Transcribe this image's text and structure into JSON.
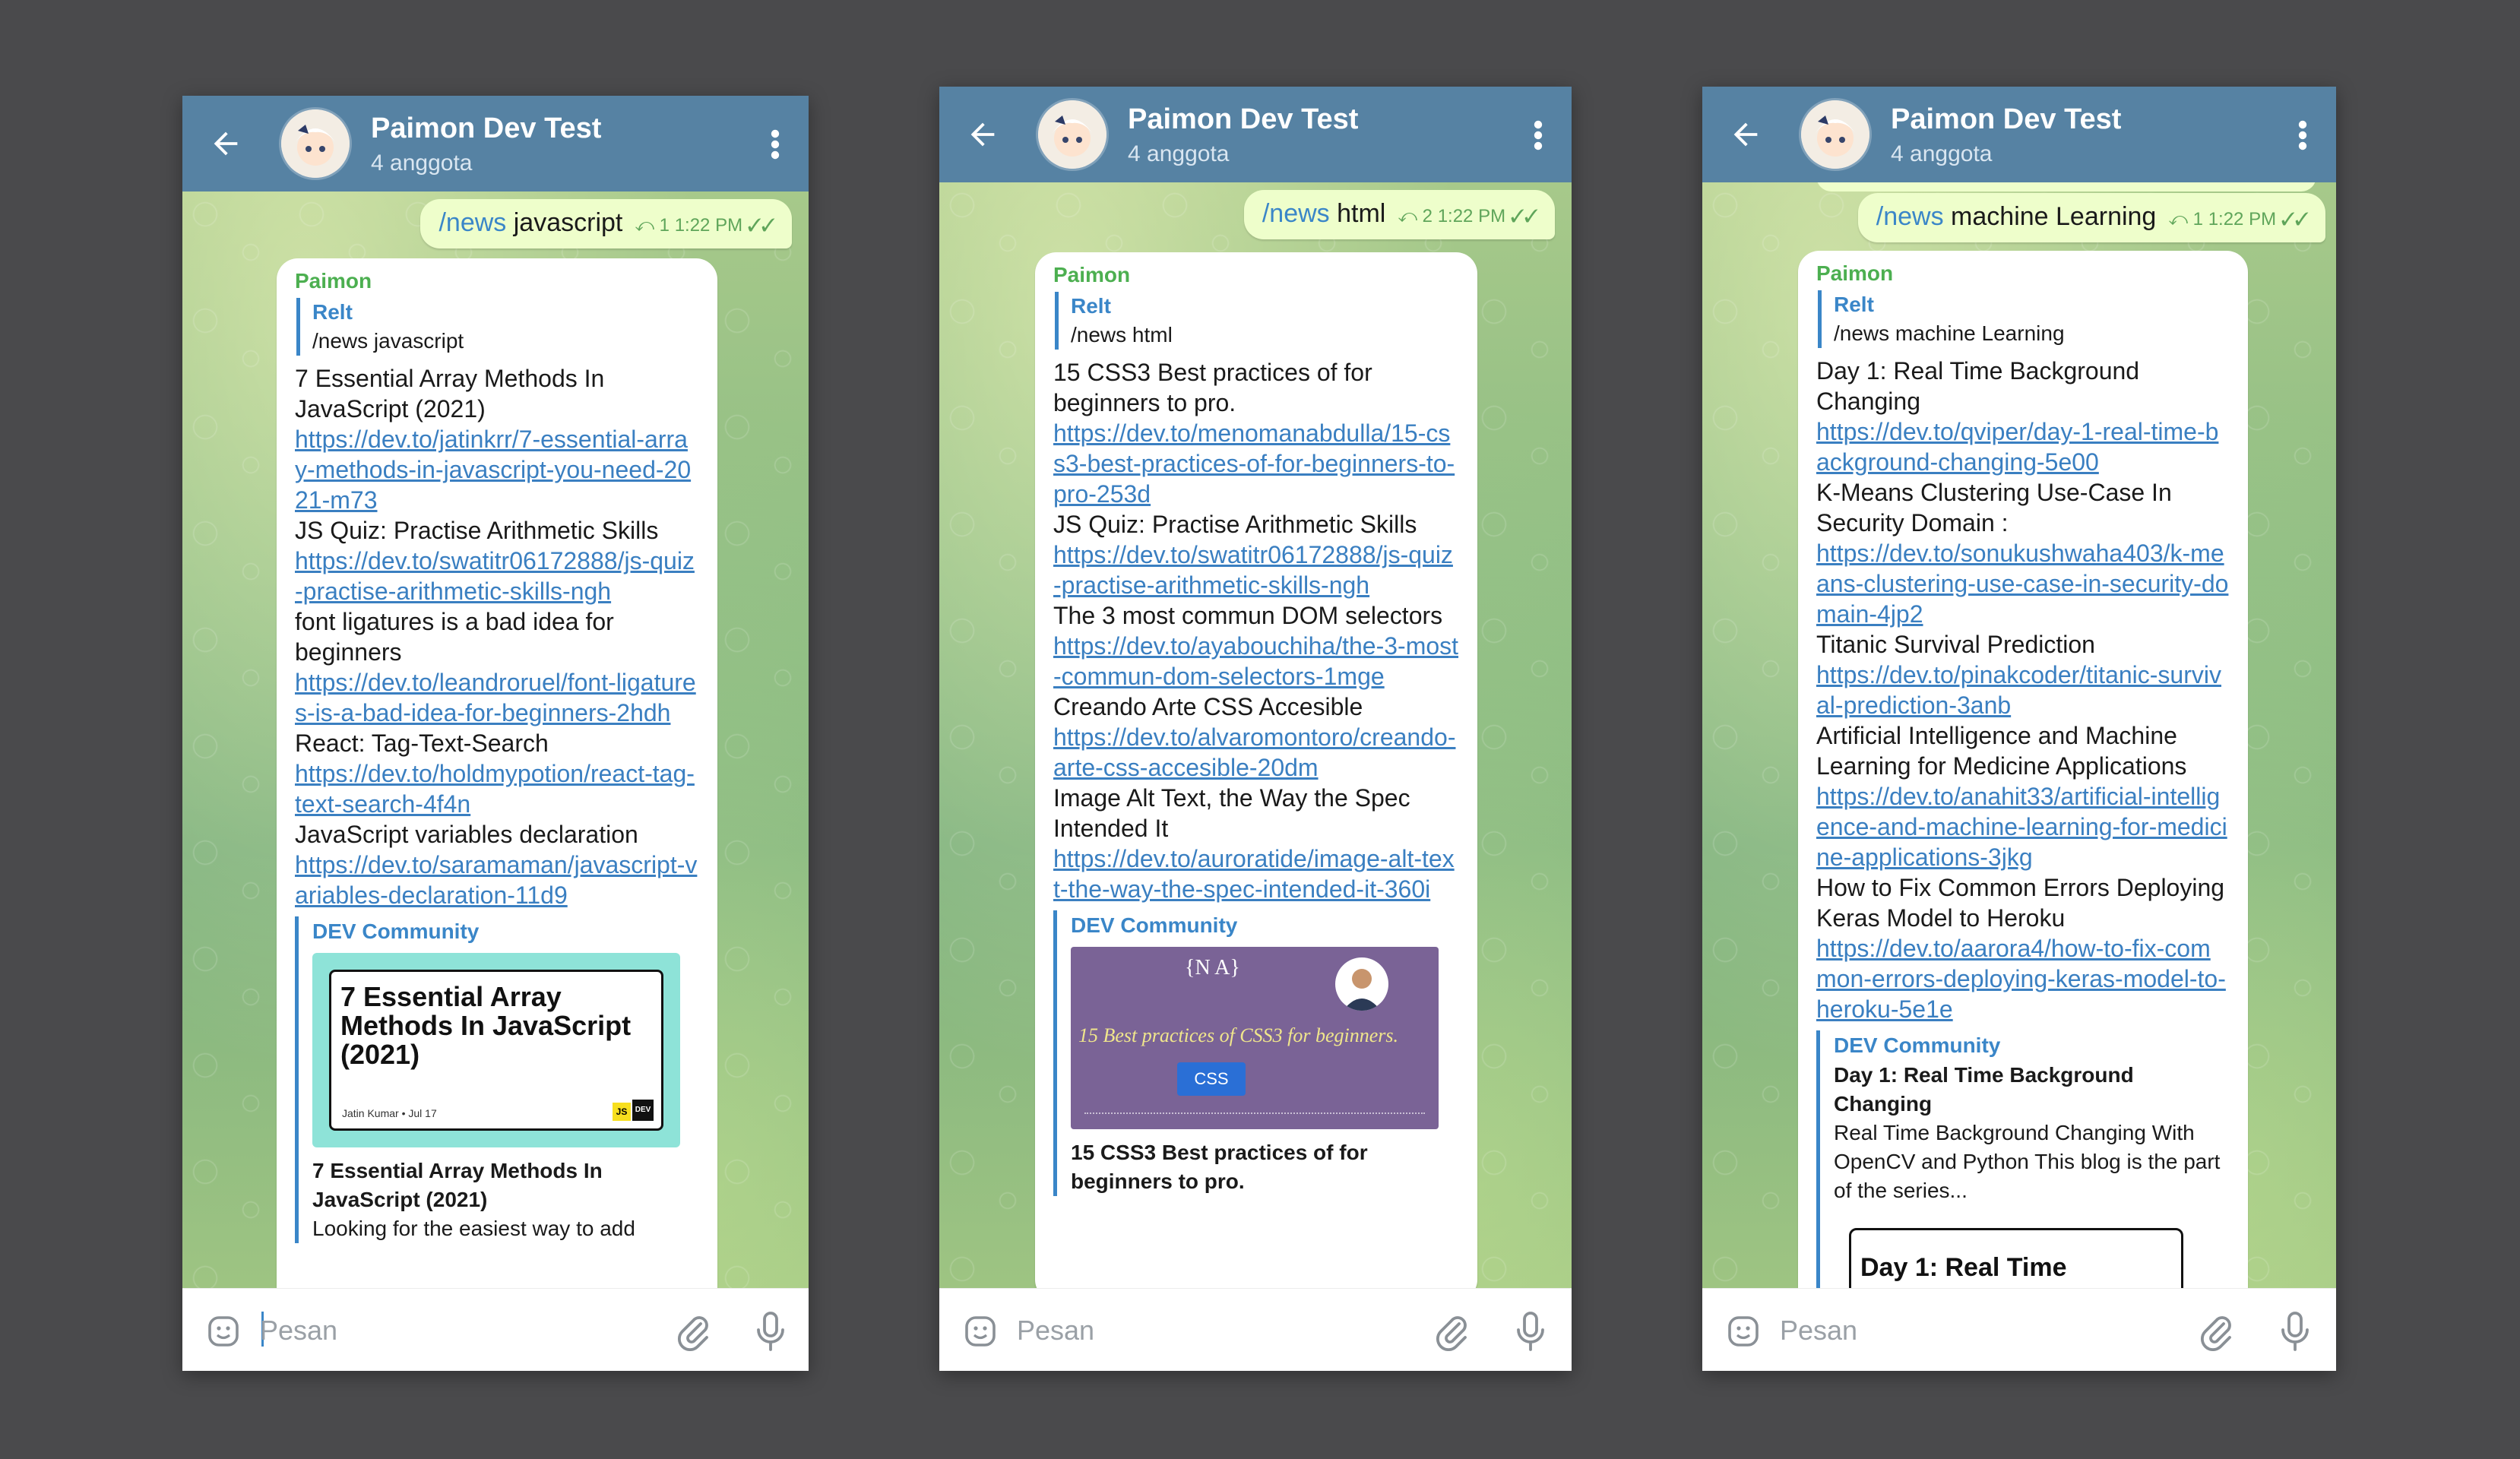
{
  "screens": [
    {
      "header": {
        "title": "Paimon Dev Test",
        "subtitle": "4 anggota"
      },
      "outgoing": {
        "command": "/news",
        "arg": " javascript",
        "meta": "⤺ 1  1:22 PM ✓✓"
      },
      "reply": {
        "sender": "Paimon",
        "quote_name": "Relt",
        "quote_text": "/news javascript",
        "items": [
          {
            "title": "7 Essential Array Methods  In JavaScript (2021)",
            "link": "https://dev.to/jatinkrr/7-essential-array-methods-in-javascript-you-need-2021-m73"
          },
          {
            "title": "JS Quiz: Practise Arithmetic Skills",
            "link": "https://dev.to/swatitr06172888/js-quiz-practise-arithmetic-skills-ngh"
          },
          {
            "title": "font ligatures is a bad idea for beginners",
            "link": "https://dev.to/leandroruel/font-ligatures-is-a-bad-idea-for-beginners-2hdh"
          },
          {
            "title": "React: Tag-Text-Search",
            "link": "https://dev.to/holdmypotion/react-tag-text-search-4f4n"
          },
          {
            "title": "JavaScript variables declaration",
            "link": "https://dev.to/saramaman/javascript-variables-declaration-11d9"
          }
        ],
        "preview": {
          "site": "DEV Community",
          "image_title": "7 Essential Array Methods In JavaScript (2021)",
          "image_author": "Jatin Kumar • Jul 17",
          "title": "7 Essential Array Methods In JavaScript (2021)",
          "desc": "Looking for the easiest way to add"
        }
      },
      "input": {
        "placeholder": "Pesan"
      }
    },
    {
      "header": {
        "title": "Paimon Dev Test",
        "subtitle": "4 anggota"
      },
      "outgoing": {
        "command": "/news",
        "arg": " html",
        "meta": "⤺ 2  1:22 PM ✓✓"
      },
      "reply": {
        "sender": "Paimon",
        "quote_name": "Relt",
        "quote_text": "/news html",
        "items": [
          {
            "title": "15 CSS3 Best practices of  for beginners to pro.",
            "link": "https://dev.to/menomanabdulla/15-css3-best-practices-of-for-beginners-to-pro-253d"
          },
          {
            "title": "JS Quiz: Practise Arithmetic Skills",
            "link": "https://dev.to/swatitr06172888/js-quiz-practise-arithmetic-skills-ngh"
          },
          {
            "title": "The 3 most commun DOM selectors",
            "link": "https://dev.to/ayabouchiha/the-3-most-commun-dom-selectors-1mge"
          },
          {
            "title": "Creando Arte CSS Accesible",
            "link": "https://dev.to/alvaromontoro/creando-arte-css-accesible-20dm"
          },
          {
            "title": "Image Alt Text, the Way the Spec Intended It",
            "link": "https://dev.to/auroratide/image-alt-text-the-way-the-spec-intended-it-360i"
          }
        ],
        "preview": {
          "site": "DEV Community",
          "image_logo": "{N A}",
          "image_caption": "15 Best practices of CSS3 for beginners.",
          "image_badge": "CSS",
          "title": "15 CSS3 Best practices of for beginners to pro."
        }
      },
      "input": {
        "placeholder": "Pesan"
      }
    },
    {
      "header": {
        "title": "Paimon Dev Test",
        "subtitle": "4 anggota"
      },
      "outgoing": {
        "command": "/news",
        "arg": " machine Learning",
        "meta": "⤺ 1  1:22 PM ✓✓"
      },
      "reply": {
        "sender": "Paimon",
        "quote_name": "Relt",
        "quote_text": "/news machine Learning",
        "items": [
          {
            "title": "Day 1: Real Time Background Changing",
            "link": "https://dev.to/qviper/day-1-real-time-background-changing-5e00"
          },
          {
            "title": "K-Means Clustering Use-Case In Security Domain :",
            "link": "https://dev.to/sonukushwaha403/k-means-clustering-use-case-in-security-domain-4jp2"
          },
          {
            "title": "Titanic Survival Prediction",
            "link": "https://dev.to/pinakcoder/titanic-survival-prediction-3anb"
          },
          {
            "title": "Artificial Intelligence and Machine Learning for Medicine Applications",
            "link": "https://dev.to/anahit33/artificial-intelligence-and-machine-learning-for-medicine-applications-3jkg"
          },
          {
            "title": "How to Fix Common Errors Deploying Keras Model to Heroku",
            "link": "https://dev.to/aarora4/how-to-fix-common-errors-deploying-keras-model-to-heroku-5e1e"
          }
        ],
        "preview": {
          "site": "DEV Community",
          "title": "Day 1: Real Time Background Changing",
          "desc": "Real Time Background Changing With OpenCV and Python This blog is the part of the series...",
          "image_title": "Day 1: Real Time"
        }
      },
      "input": {
        "placeholder": "Pesan"
      }
    }
  ]
}
